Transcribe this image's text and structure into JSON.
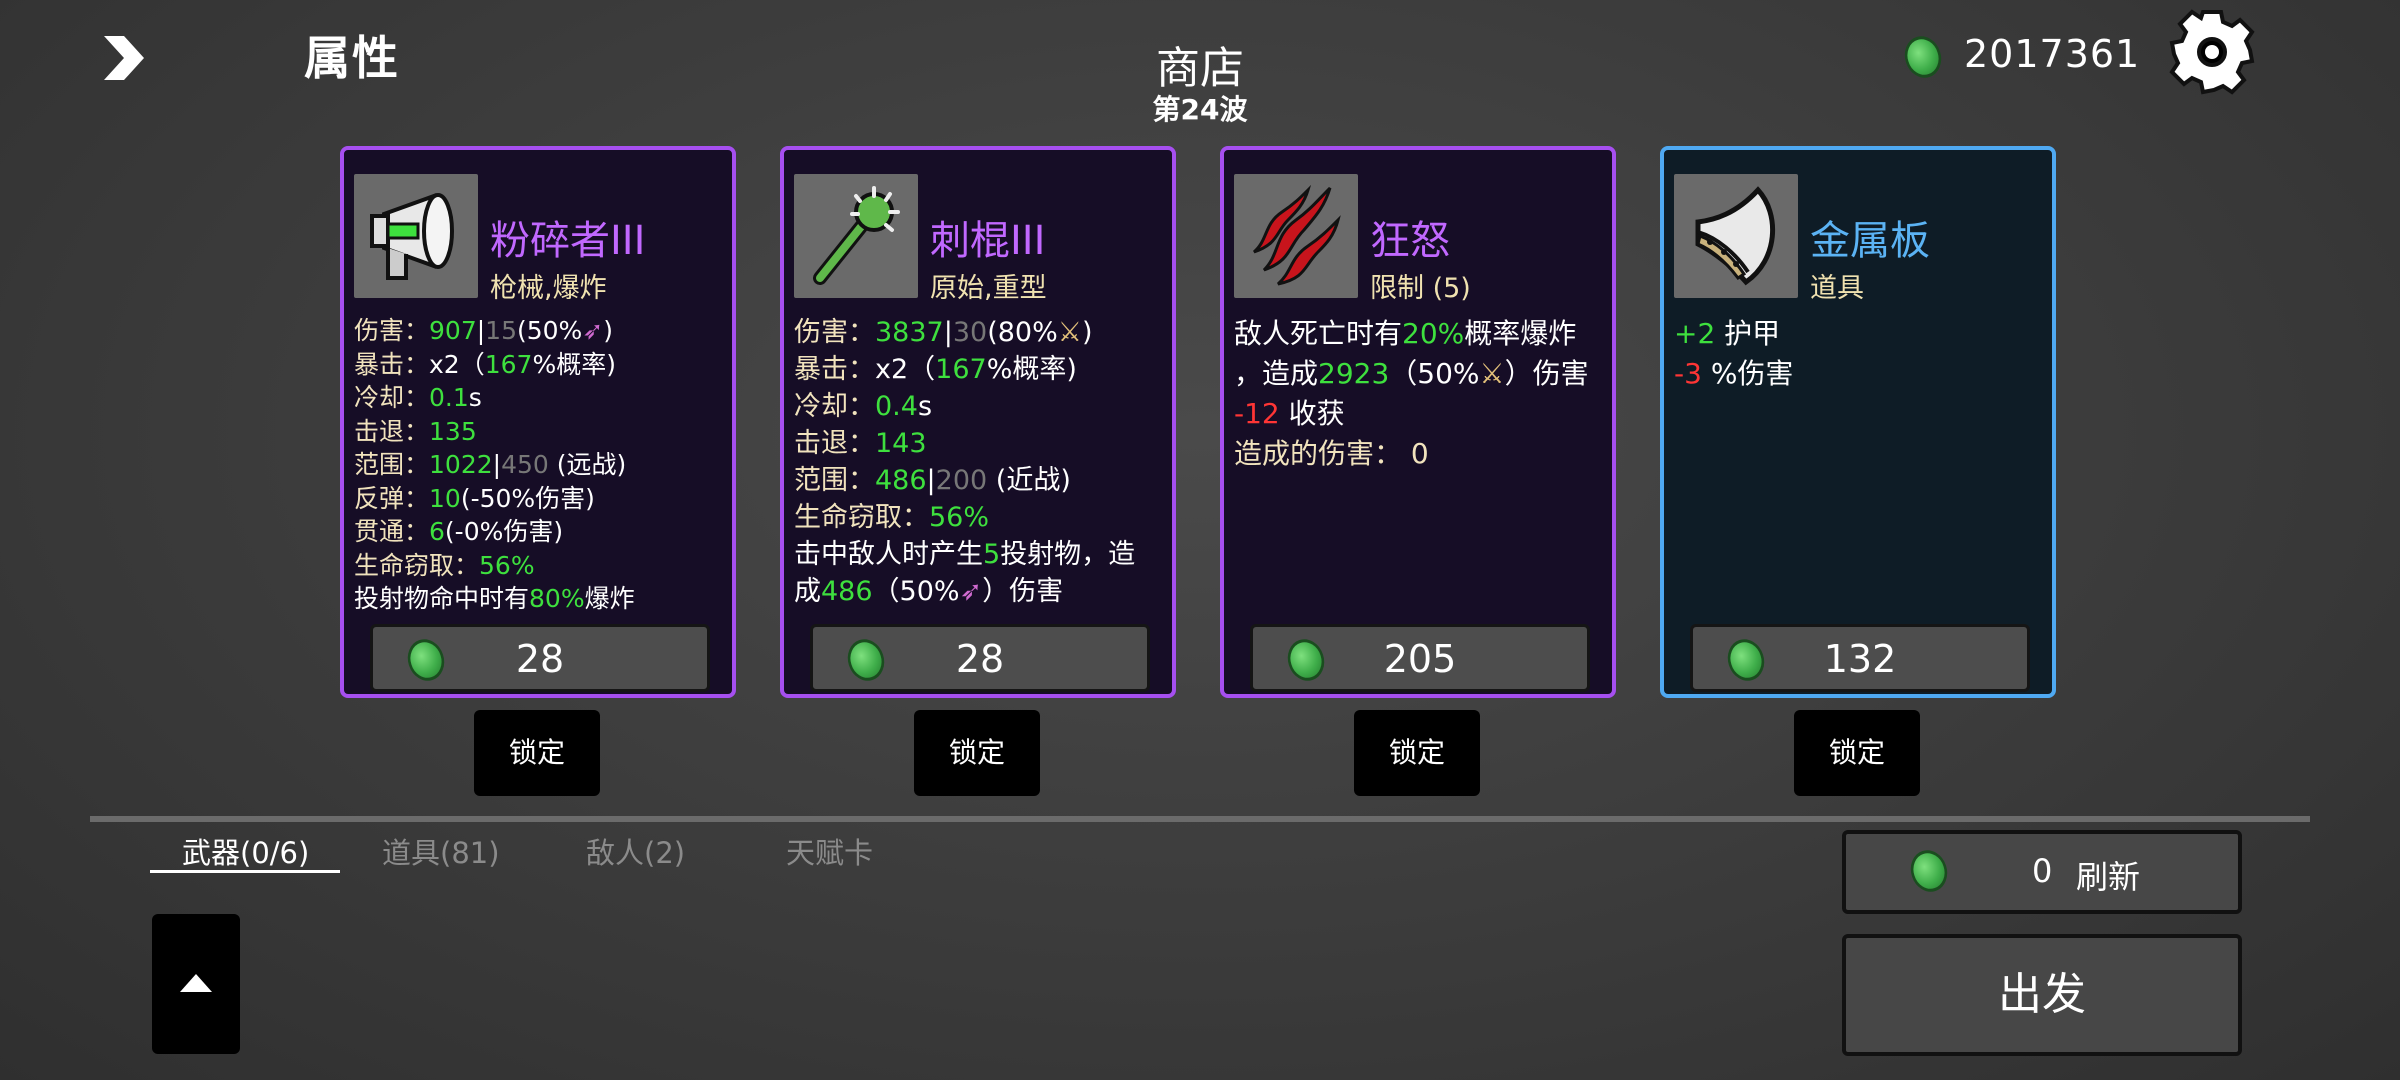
{
  "header": {
    "attributes_label": "属性",
    "shop_title": "商店",
    "wave": "第24波",
    "money": "2017361"
  },
  "colors": {
    "weapon_border": "#a64ff0",
    "item_border": "#4fa9f2",
    "positive": "#3ee03e",
    "negative": "#ff3535"
  },
  "cards": [
    {
      "icon": "megaphone-gun-icon",
      "name": "粉碎者III",
      "tags": "枪械,爆炸",
      "stats": {
        "damage_label": "伤害：",
        "damage": "907",
        "damage_sep": "|",
        "damage_base": "15",
        "damage_scale": "(50%",
        "damage_end": ")",
        "crit_label": "暴击：",
        "crit_mult": "x2（",
        "crit_chance": "167",
        "crit_end": "%概率)",
        "cooldown_label": "冷却：",
        "cooldown": "0.1",
        "cooldown_unit": "s",
        "knockback_label": "击退：",
        "knockback": "135",
        "range_label": "范围：",
        "range": "1022",
        "range_sep": "|",
        "range_base": "450",
        "range_type": " (远战)",
        "bounce_label": "反弹：",
        "bounce": "10",
        "bounce_note": "(-50%伤害)",
        "pierce_label": "贯通：",
        "pierce": "6",
        "pierce_note": "(-0%伤害)",
        "lifesteal_label": "生命窃取：",
        "lifesteal": "56%",
        "special_a": "投射物命中时有",
        "special_pct": "80%",
        "special_b": "爆炸"
      },
      "price": "28",
      "lock_label": "锁定"
    },
    {
      "icon": "spiked-club-icon",
      "name": "刺棍III",
      "tags": "原始,重型",
      "stats": {
        "damage_label": "伤害：",
        "damage": "3837",
        "damage_sep": "|",
        "damage_base": "30",
        "damage_scale": "(80%",
        "damage_end": ")",
        "crit_label": "暴击：",
        "crit_mult": "x2（",
        "crit_chance": "167",
        "crit_end": "%概率)",
        "cooldown_label": "冷却：",
        "cooldown": "0.4",
        "cooldown_unit": "s",
        "knockback_label": "击退：",
        "knockback": "143",
        "range_label": "范围：",
        "range": "486",
        "range_sep": "|",
        "range_base": "200",
        "range_type": " (近战)",
        "lifesteal_label": "生命窃取：",
        "lifesteal": "56%",
        "special_a": "击中敌人时产生",
        "special_count": "5",
        "special_b": "投射物，造",
        "special_c": "成",
        "special_dmg": "486",
        "special_d": "（50%",
        "special_e": "）伤害"
      },
      "price": "28",
      "lock_label": "锁定"
    },
    {
      "icon": "rage-claw-icon",
      "name": "狂怒",
      "tags": "限制 (5)",
      "stats": {
        "line1_a": "敌人死亡时有",
        "line1_pct": "20%",
        "line1_b": "概率爆炸",
        "line2_a": "，造成",
        "line2_dmg": "2923",
        "line2_b": "（50%",
        "line2_c": "）伤害",
        "line3_val": "-12",
        "line3_label": " 收获",
        "line4": "造成的伤害：  0"
      },
      "price": "205",
      "lock_label": "锁定"
    },
    {
      "icon": "metal-plate-icon",
      "name": "金属板",
      "tags": "道具",
      "stats": {
        "armor_val": "+2",
        "armor_label": " 护甲",
        "dmg_val": "-3",
        "dmg_label": " %伤害"
      },
      "price": "132",
      "lock_label": "锁定"
    }
  ],
  "tabs": [
    {
      "label": "武器(0/6)",
      "active": true
    },
    {
      "label": "道具(81)",
      "active": false
    },
    {
      "label": "敌人(2)",
      "active": false
    },
    {
      "label": "天赋卡",
      "active": false
    }
  ],
  "refresh": {
    "cost": "0",
    "label": "刷新"
  },
  "depart_label": "出发"
}
